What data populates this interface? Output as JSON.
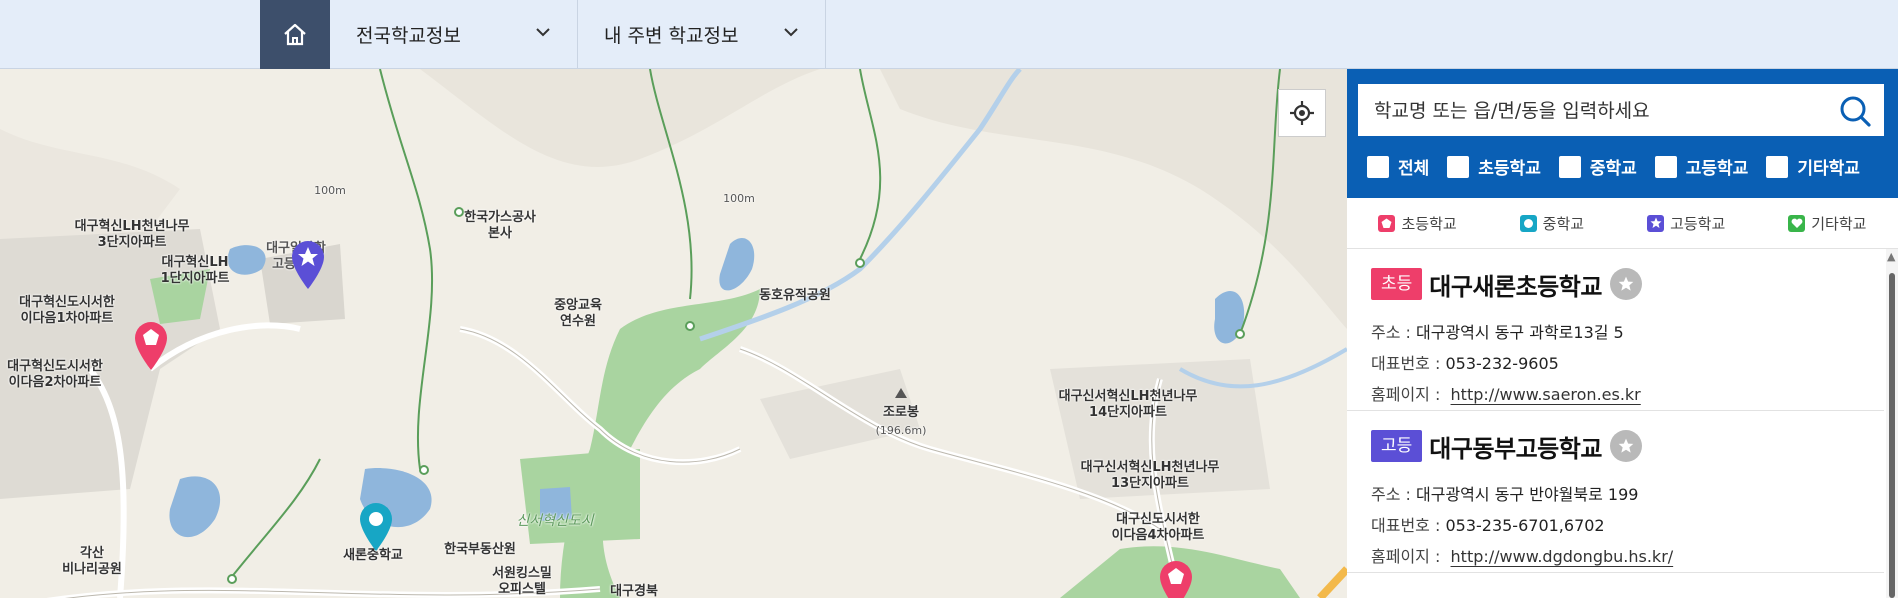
{
  "nav": {
    "home_icon": "home-icon",
    "items": [
      {
        "label": "전국학교정보"
      },
      {
        "label": "내 주변 학교정보"
      }
    ]
  },
  "map": {
    "labels": [
      {
        "text": "대구혁신LH천년나무\n3단지아파트"
      },
      {
        "text": "대구혁신LH\n1단지아파트"
      },
      {
        "text": "대구혁신도시서한\n이다음1차아파트"
      },
      {
        "text": "대구혁신도시서한\n이다음2차아파트"
      },
      {
        "text": "대구일과학\n고등학교"
      },
      {
        "text": "100m"
      },
      {
        "text": "한국가스공사\n본사"
      },
      {
        "text": "중앙교육\n연수원"
      },
      {
        "text": "100m"
      },
      {
        "text": "동호유적공원"
      },
      {
        "text": "조로봉"
      },
      {
        "text": "(196.6m)"
      },
      {
        "text": "대구신서혁신LH천년나무\n14단지아파트"
      },
      {
        "text": "대구신서혁신LH천년나무\n13단지아파트"
      },
      {
        "text": "대구신도시서한\n이다음4차아파트"
      },
      {
        "text": "새론중학교"
      },
      {
        "text": "한국부동산원"
      },
      {
        "text": "신서혁신도시"
      },
      {
        "text": "서원킹스밀\n오피스텔"
      },
      {
        "text": "대구경북"
      },
      {
        "text": "각산\n비나리공원"
      }
    ],
    "pins": [
      {
        "kind": "high",
        "color": "#5b4fd6",
        "icon": "star-pin-icon"
      },
      {
        "kind": "elementary",
        "color": "#ee3e6a",
        "icon": "pentagon-pin-icon"
      },
      {
        "kind": "middle",
        "color": "#17a6c5",
        "icon": "circle-pin-icon"
      },
      {
        "kind": "elementary",
        "color": "#ee3e6a",
        "icon": "pentagon-pin-icon"
      }
    ],
    "locate_icon": "crosshair-icon"
  },
  "search": {
    "placeholder": "학교명 또는 읍/면/동을 입력하세요",
    "icon": "search-icon"
  },
  "filters": [
    {
      "label": "전체"
    },
    {
      "label": "초등학교"
    },
    {
      "label": "중학교"
    },
    {
      "label": "고등학교"
    },
    {
      "label": "기타학교"
    }
  ],
  "legend": [
    {
      "label": "초등학교",
      "color": "#ee3e6a",
      "icon": "pentagon-icon"
    },
    {
      "label": "중학교",
      "color": "#17a6c5",
      "icon": "circle-icon"
    },
    {
      "label": "고등학교",
      "color": "#5b4fd6",
      "icon": "star-icon"
    },
    {
      "label": "기타학교",
      "color": "#39b54a",
      "icon": "heart-icon"
    }
  ],
  "schools": [
    {
      "badge": "초등",
      "badge_color": "#ee3e6a",
      "name": "대구새론초등학교",
      "addr_key": "주소 :",
      "addr": "대구광역시 동구 과학로13길 5",
      "phone_key": "대표번호 :",
      "phone": "053-232-9605",
      "home_key": "홈페이지 :",
      "home": "http://www.saeron.es.kr"
    },
    {
      "badge": "고등",
      "badge_color": "#5b4fd6",
      "name": "대구동부고등학교",
      "addr_key": "주소 :",
      "addr": "대구광역시 동구 반야월북로 199",
      "phone_key": "대표번호 :",
      "phone": "053-235-6701,6702",
      "home_key": "홈페이지 :",
      "home": "http://www.dgdongbu.hs.kr/"
    }
  ]
}
